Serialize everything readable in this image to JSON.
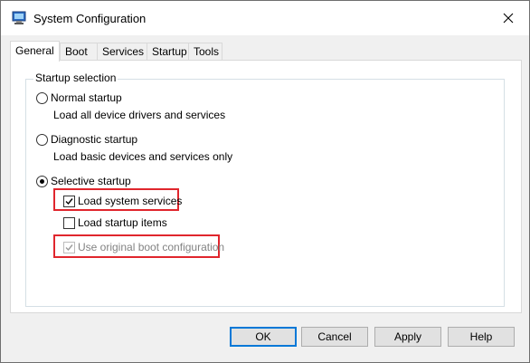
{
  "window": {
    "title": "System Configuration",
    "app_icon": "msconfig-computer-icon",
    "close_icon": "close-icon"
  },
  "tabs": [
    {
      "label": "General",
      "active": true
    },
    {
      "label": "Boot",
      "active": false
    },
    {
      "label": "Services",
      "active": false
    },
    {
      "label": "Startup",
      "active": false
    },
    {
      "label": "Tools",
      "active": false
    }
  ],
  "general": {
    "group_label": "Startup selection",
    "normal": {
      "label": "Normal startup",
      "description": "Load all device drivers and services",
      "selected": false
    },
    "diagnostic": {
      "label": "Diagnostic startup",
      "description": "Load basic devices and services only",
      "selected": false
    },
    "selective": {
      "label": "Selective startup",
      "selected": true,
      "options": [
        {
          "label": "Load system services",
          "checked": true,
          "enabled": true,
          "highlighted": true
        },
        {
          "label": "Load startup items",
          "checked": false,
          "enabled": true,
          "highlighted": false
        },
        {
          "label": "Use original boot configuration",
          "checked": true,
          "enabled": false,
          "highlighted": true
        }
      ]
    }
  },
  "buttons": {
    "ok": "OK",
    "cancel": "Cancel",
    "apply": "Apply",
    "help": "Help"
  },
  "colors": {
    "highlight_box": "#e0262d",
    "default_button_border": "#0078d7"
  }
}
